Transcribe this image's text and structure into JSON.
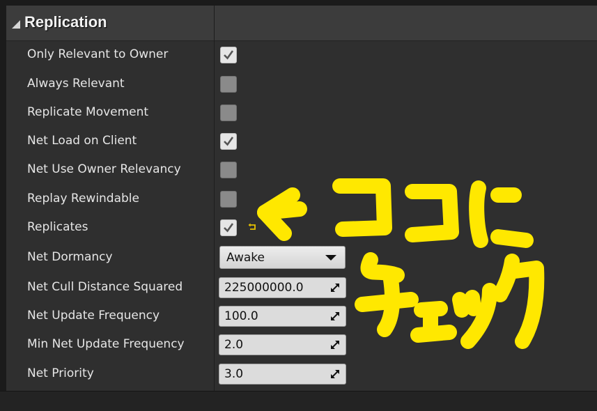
{
  "section": {
    "title": "Replication"
  },
  "properties": [
    {
      "label": "Only Relevant to Owner",
      "type": "checkbox",
      "checked": true
    },
    {
      "label": "Always Relevant",
      "type": "checkbox",
      "checked": false
    },
    {
      "label": "Replicate Movement",
      "type": "checkbox",
      "checked": false
    },
    {
      "label": "Net Load on Client",
      "type": "checkbox",
      "checked": true
    },
    {
      "label": "Net Use Owner Relevancy",
      "type": "checkbox",
      "checked": false
    },
    {
      "label": "Replay Rewindable",
      "type": "checkbox",
      "checked": false
    },
    {
      "label": "Replicates",
      "type": "checkbox",
      "checked": true
    },
    {
      "label": "Net Dormancy",
      "type": "dropdown",
      "value": "Awake"
    },
    {
      "label": "Net Cull Distance Squared",
      "type": "number",
      "value": "225000000.0"
    },
    {
      "label": "Net Update Frequency",
      "type": "number",
      "value": "100.0"
    },
    {
      "label": "Min Net Update Frequency",
      "type": "number",
      "value": "2.0"
    },
    {
      "label": "Net Priority",
      "type": "number",
      "value": "3.0"
    }
  ],
  "annotation": {
    "line1": "ココに",
    "line2": "チェック",
    "color": "#ffe800"
  },
  "icons": {
    "checkmark": "checkmark-icon",
    "reset": "reset-to-default-icon",
    "spin": "numeric-drag-icon",
    "dropdown": "chevron-down-icon"
  }
}
